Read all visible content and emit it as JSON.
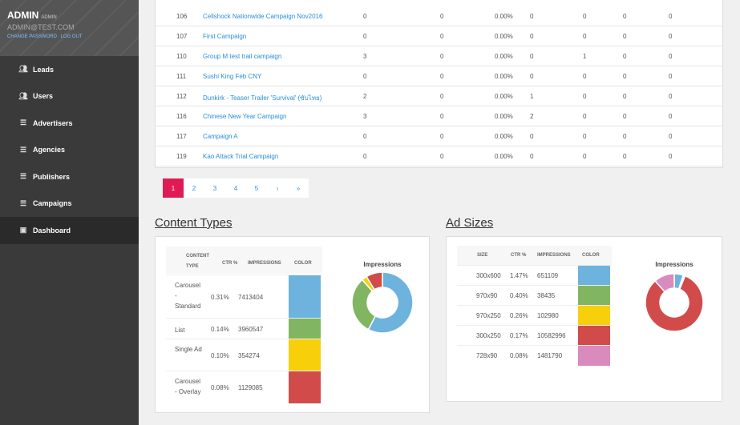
{
  "sidebar": {
    "user": {
      "name": "ADMIN",
      "role": "ADMIN",
      "email": "ADMIN@TEST.COM",
      "change_password": "CHANGE PASSWORD",
      "logout": "LOG OUT"
    },
    "items": [
      {
        "label": "Leads",
        "icon": "people-icon"
      },
      {
        "label": "Users",
        "icon": "people-icon"
      },
      {
        "label": "Advertisers",
        "icon": "list-icon"
      },
      {
        "label": "Agencies",
        "icon": "list-icon"
      },
      {
        "label": "Publishers",
        "icon": "list-icon"
      },
      {
        "label": "Campaigns",
        "icon": "list-icon"
      },
      {
        "label": "Dashboard",
        "icon": "chart-icon"
      }
    ]
  },
  "table": {
    "rows": [
      {
        "id": "106",
        "name": "Cellshock Nationwide Campaign Nov2016",
        "c1": "0",
        "c2": "0",
        "pct": "0.00%",
        "c3": "0",
        "c4": "0",
        "c5": "0",
        "c6": "0"
      },
      {
        "id": "107",
        "name": "First Campaign",
        "c1": "0",
        "c2": "0",
        "pct": "0.00%",
        "c3": "0",
        "c4": "0",
        "c5": "0",
        "c6": "0"
      },
      {
        "id": "110",
        "name": "Group M test trail campaign",
        "c1": "3",
        "c2": "0",
        "pct": "0.00%",
        "c3": "0",
        "c4": "1",
        "c5": "0",
        "c6": "0"
      },
      {
        "id": "111",
        "name": "Sushi King Feb CNY",
        "c1": "0",
        "c2": "0",
        "pct": "0.00%",
        "c3": "0",
        "c4": "0",
        "c5": "0",
        "c6": "0"
      },
      {
        "id": "112",
        "name": "Dunkirk - Teaser Trailer 'Survival' (ซับไทย)",
        "c1": "2",
        "c2": "0",
        "pct": "0.00%",
        "c3": "1",
        "c4": "0",
        "c5": "0",
        "c6": "0"
      },
      {
        "id": "116",
        "name": "Chinese New Year Campaign",
        "c1": "3",
        "c2": "0",
        "pct": "0.00%",
        "c3": "2",
        "c4": "0",
        "c5": "0",
        "c6": "0"
      },
      {
        "id": "117",
        "name": "Campaign A",
        "c1": "0",
        "c2": "0",
        "pct": "0.00%",
        "c3": "0",
        "c4": "0",
        "c5": "0",
        "c6": "0"
      },
      {
        "id": "119",
        "name": "Kao Attack Trial Campaign",
        "c1": "0",
        "c2": "0",
        "pct": "0.00%",
        "c3": "0",
        "c4": "0",
        "c5": "0",
        "c6": "0"
      }
    ]
  },
  "pagination": {
    "pages": [
      "1",
      "2",
      "3",
      "4",
      "5"
    ],
    "next": "›",
    "last": "»"
  },
  "content_types": {
    "title": "Content Types",
    "headers": {
      "type": "CONTENT TYPE",
      "ctr": "CTR %",
      "impressions": "IMPRESSIONS",
      "color": "COLOR"
    },
    "rows": [
      {
        "type": "Carousel - Standard",
        "ctr": "0.31%",
        "impressions": "7413404",
        "color": "#6db3dd"
      },
      {
        "type": "List",
        "ctr": "0.14%",
        "impressions": "3960547",
        "color": "#82b562"
      },
      {
        "type": "Single Ad",
        "ctr": "0.10%",
        "impressions": "354274",
        "color": "#f7cf0a"
      },
      {
        "type": "Carousel - Overlay",
        "ctr": "0.08%",
        "impressions": "1129085",
        "color": "#d24b4b"
      }
    ],
    "chart_title": "Impressions"
  },
  "ad_sizes": {
    "title": "Ad Sizes",
    "headers": {
      "size": "SIZE",
      "ctr": "CTR %",
      "impressions": "IMPRESSIONS",
      "color": "COLOR"
    },
    "rows": [
      {
        "size": "300x600",
        "ctr": "1.47%",
        "impressions": "651109",
        "color": "#6db3dd"
      },
      {
        "size": "970x90",
        "ctr": "0.40%",
        "impressions": "38435",
        "color": "#82b562"
      },
      {
        "size": "970x250",
        "ctr": "0.26%",
        "impressions": "102980",
        "color": "#f7cf0a"
      },
      {
        "size": "300x250",
        "ctr": "0.17%",
        "impressions": "10582996",
        "color": "#d24b4b"
      },
      {
        "size": "728x90",
        "ctr": "0.08%",
        "impressions": "1481790",
        "color": "#d98bbd"
      }
    ],
    "chart_title": "Impressions"
  },
  "chart_data": [
    {
      "type": "pie",
      "title": "Impressions",
      "categories": [
        "Carousel - Standard",
        "List",
        "Single Ad",
        "Carousel - Overlay"
      ],
      "values": [
        7413404,
        3960547,
        354274,
        1129085
      ],
      "colors": [
        "#6db3dd",
        "#82b562",
        "#f7cf0a",
        "#d24b4b"
      ]
    },
    {
      "type": "pie",
      "title": "Impressions",
      "categories": [
        "300x600",
        "970x90",
        "970x250",
        "300x250",
        "728x90"
      ],
      "values": [
        651109,
        38435,
        102980,
        10582996,
        1481790
      ],
      "colors": [
        "#6db3dd",
        "#82b562",
        "#f7cf0a",
        "#d24b4b",
        "#d98bbd"
      ]
    }
  ]
}
